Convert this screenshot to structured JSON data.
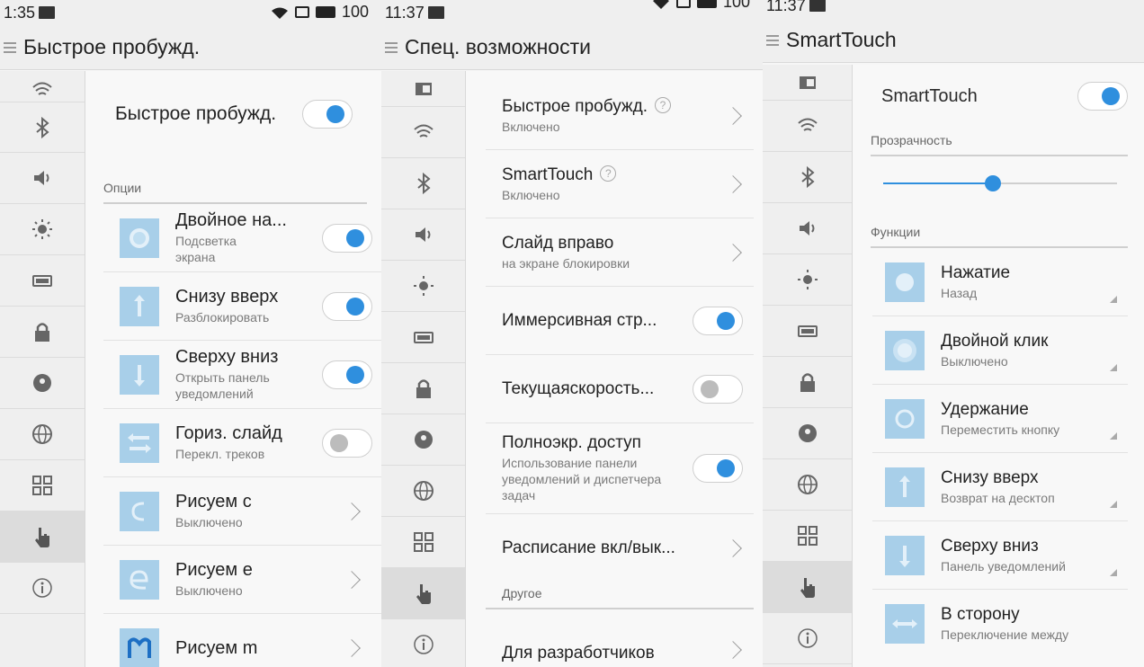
{
  "colors": {
    "accent": "#2f8fde",
    "thumb": "#a8cfe9",
    "active_side": "#dcdcdc"
  },
  "screen1": {
    "status": {
      "time": "1:35",
      "battery": "100"
    },
    "title": "Быстрое пробужд.",
    "main_toggle": {
      "label": "Быстрое пробужд.",
      "on": true
    },
    "section": "Опции",
    "options": [
      {
        "label": "Двойное на...",
        "sub": "Подсветка экрана",
        "control": "toggle-on",
        "icon": "circle-icon"
      },
      {
        "label": "Снизу вверх",
        "sub": "Разблокировать",
        "control": "toggle-on",
        "icon": "arrow-up-icon"
      },
      {
        "label": "Сверху вниз",
        "sub": "Открыть панель уведомлений",
        "control": "toggle-on",
        "icon": "arrow-down-icon"
      },
      {
        "label": "Гориз. слайд",
        "sub": "Перекл. треков",
        "control": "toggle-off",
        "icon": "horizontal-arrows-icon"
      },
      {
        "label": "Рисуем с",
        "sub": "Выключено",
        "control": "chevron",
        "icon": "draw-c-icon"
      },
      {
        "label": "Рисуем е",
        "sub": "Выключено",
        "control": "chevron",
        "icon": "draw-e-icon"
      },
      {
        "label": "Рисуем m",
        "sub": "",
        "control": "chevron",
        "icon": "draw-m-icon"
      }
    ]
  },
  "screen2": {
    "status": {
      "time": "11:37",
      "battery": "100"
    },
    "title": "Спец. возможности",
    "items": [
      {
        "label": "Быстрое пробужд.",
        "sub": "Включено",
        "help": "?",
        "control": "chevron"
      },
      {
        "label": "SmartTouch",
        "sub": "Включено",
        "help": "?",
        "control": "chevron"
      },
      {
        "label": "Слайд вправо",
        "sub": "на экране блокировки",
        "control": "chevron"
      },
      {
        "label": "Иммерсивная стр...",
        "sub": "",
        "control": "toggle-on"
      },
      {
        "label": "Текущаяскорость...",
        "sub": "",
        "control": "toggle-off"
      },
      {
        "label": "Полноэкр. доступ",
        "sub": "Использование панели уведомлений и диспетчера задач",
        "control": "toggle-on"
      },
      {
        "label": "Расписание вкл/вык...",
        "sub": "",
        "control": "chevron"
      }
    ],
    "section": "Другое",
    "last_item": {
      "label": "Для разработчиков"
    }
  },
  "screen3": {
    "status": {
      "time": "11:37"
    },
    "title": "SmartTouch",
    "main_toggle": {
      "label": "SmartTouch",
      "on": true
    },
    "transparency_label": "Прозрачность",
    "transparency_value": 0.47,
    "functions_label": "Функции",
    "functions": [
      {
        "label": "Нажатие",
        "sub": "Назад",
        "icon": "circle-icon"
      },
      {
        "label": "Двойной клик",
        "sub": "Выключено",
        "icon": "double-circle-icon"
      },
      {
        "label": "Удержание",
        "sub": "Переместить кнопку",
        "icon": "ring-icon"
      },
      {
        "label": "Снизу вверх",
        "sub": "Возврат на десктоп",
        "icon": "arrow-up-icon"
      },
      {
        "label": "Сверху вниз",
        "sub": "Панель уведомлений",
        "icon": "arrow-down-icon"
      },
      {
        "label": "В сторону",
        "sub": "Переключение между",
        "icon": "horizontal-arrows-icon"
      }
    ]
  },
  "sidebar_icons": [
    "wifi-icon",
    "bluetooth-icon",
    "sound-icon",
    "brightness-icon",
    "battery-icon",
    "lock-icon",
    "location-icon",
    "globe-icon",
    "apps-grid-icon",
    "hand-pointer-icon",
    "info-icon"
  ]
}
